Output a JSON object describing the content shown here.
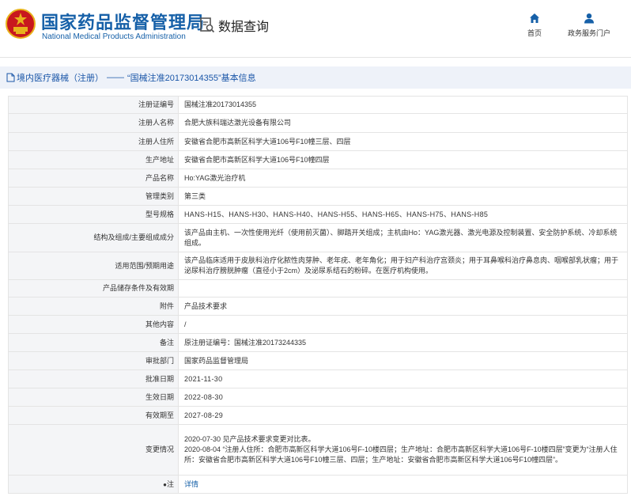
{
  "header": {
    "site_title_cn": "国家药品监督管理局",
    "site_title_en": "National Medical Products Administration",
    "query_label": "数据查询",
    "nav": [
      {
        "label": "首页",
        "icon": "home-icon"
      },
      {
        "label": "政务服务门户",
        "icon": "user-icon"
      }
    ]
  },
  "banner": {
    "category": "境内医疗器械（注册）",
    "separator": "——",
    "record_title": "“国械注准20173014355”基本信息"
  },
  "colors": {
    "brand_blue": "#1660a8",
    "banner_bg": "#eef2f9",
    "key_cell_bg": "#f4f5f7",
    "logo_red": "#c8171e",
    "logo_gold": "#e8b21c"
  },
  "record": [
    {
      "key": "注册证编号",
      "value": "国械注准20173014355"
    },
    {
      "key": "注册人名称",
      "value": "合肥大族科瑞达激光设备有限公司"
    },
    {
      "key": "注册人住所",
      "value": "安徽省合肥市高新区科学大道106号F10幢三层、四层"
    },
    {
      "key": "生产地址",
      "value": "安徽省合肥市高新区科学大道106号F10幢四层"
    },
    {
      "key": "产品名称",
      "value": "Ho:YAG激光治疗机"
    },
    {
      "key": "管理类别",
      "value": "第三类"
    },
    {
      "key": "型号规格",
      "value": "HANS-H15、HANS-H30、HANS-H40、HANS-H55、HANS-H65、HANS-H75、HANS-H85"
    },
    {
      "key": "结构及组成/主要组成成分",
      "value": "该产品由主机、一次性使用光纤（使用前灭菌）、脚踏开关组成；主机由Ho：YAG激光器、激光电源及控制装置、安全防护系统、冷却系统组成。"
    },
    {
      "key": "适用范围/预期用途",
      "value": "该产品临床适用于皮肤科治疗化脓性肉芽肿、老年疣、老年角化；用于妇产科治疗宫颈炎；用于耳鼻喉科治疗鼻息肉、咽喉部乳状瘤；用于泌尿科治疗膀胱肿瘤（直径小于2cm）及泌尿系结石的粉碎。在医疗机构使用。"
    },
    {
      "key": "产品储存条件及有效期",
      "value": ""
    },
    {
      "key": "附件",
      "value": "产品技术要求"
    },
    {
      "key": "其他内容",
      "value": "/"
    },
    {
      "key": "备注",
      "value": "原注册证编号：国械注准20173244335"
    },
    {
      "key": "审批部门",
      "value": "国家药品监督管理局"
    },
    {
      "key": "批准日期",
      "value": "2021-11-30"
    },
    {
      "key": "生效日期",
      "value": "2022-08-30"
    },
    {
      "key": "有效期至",
      "value": "2027-08-29"
    },
    {
      "key": "变更情况",
      "value": "2020-07-30 见产品技术要求变更对比表。\n2020-08-04 “注册人住所：合肥市高新区科学大道106号F-10楼四层；生产地址：合肥市高新区科学大道106号F-10楼四层”变更为“注册人住所：安徽省合肥市高新区科学大道106号F10幢三层、四层；生产地址：安徽省合肥市高新区科学大道106号F10幢四层”。"
    },
    {
      "key": "注",
      "value": "详情"
    }
  ]
}
